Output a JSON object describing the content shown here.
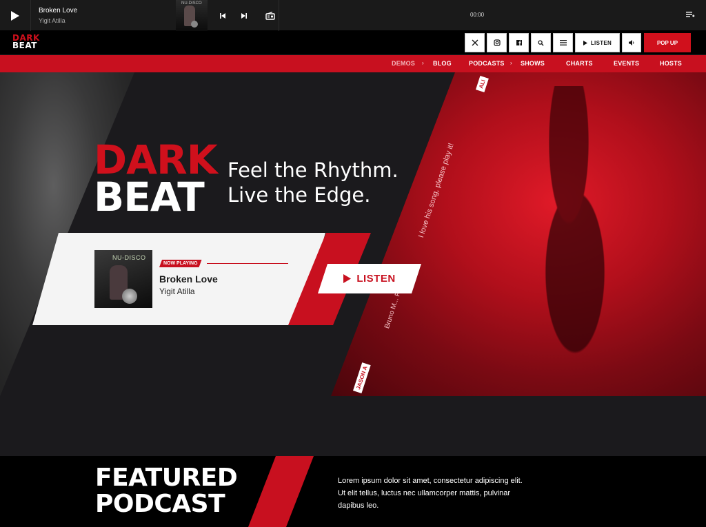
{
  "player": {
    "track_title": "Broken Love",
    "track_artist": "Yigit Atilla",
    "cover_text": "NU-DISCO",
    "time": "00:00",
    "icons": [
      "play-icon",
      "skip-back-icon",
      "skip-forward-icon",
      "radio-icon",
      "playlist-icon"
    ]
  },
  "header": {
    "logo_line1": "DARK",
    "logo_line2": "BEAT",
    "social_icons": [
      "x-icon",
      "instagram-icon",
      "facebook-icon",
      "search-icon",
      "menu-icon"
    ],
    "listen_label": "LISTEN",
    "popup_label": "POP UP"
  },
  "nav": {
    "items": [
      {
        "label": "DEMOS",
        "has_arrow": true
      },
      {
        "label": "BLOG",
        "has_arrow": false
      },
      {
        "label": "PODCASTS",
        "has_arrow": true
      },
      {
        "label": "SHOWS",
        "has_arrow": false
      },
      {
        "label": "CHARTS",
        "has_arrow": false
      },
      {
        "label": "EVENTS",
        "has_arrow": false
      },
      {
        "label": "HOSTS",
        "has_arrow": false
      }
    ]
  },
  "hero": {
    "logo_line1": "DARK",
    "logo_line2": "BEAT",
    "tagline_line1": "Feel the Rhythm.",
    "tagline_line2": "Live the Edge.",
    "overlay_quote": "I love his song, please play it!",
    "overlay_name": "Bruno M... Rain",
    "tag_top": "ALI",
    "tag_bottom": "JASON A",
    "now_playing": {
      "badge": "NOW PLAYING",
      "title": "Broken Love",
      "artist": "Yigit Atilla",
      "cover_text": "NU-DISCO"
    },
    "listen_label": "LISTEN"
  },
  "featured": {
    "title_line1": "FEATURED",
    "title_line2": "PODCAST",
    "description_line1": "Lorem ipsum dolor sit amet, consectetur adipiscing elit.",
    "description_line2": "Ut elit tellus, luctus nec ullamcorper mattis, pulvinar",
    "description_line3": "dapibus leo."
  },
  "colors": {
    "accent": "#c8101f",
    "background": "#1b1a1d",
    "player_bg": "#1a1a1a",
    "header_bg": "#000000"
  }
}
